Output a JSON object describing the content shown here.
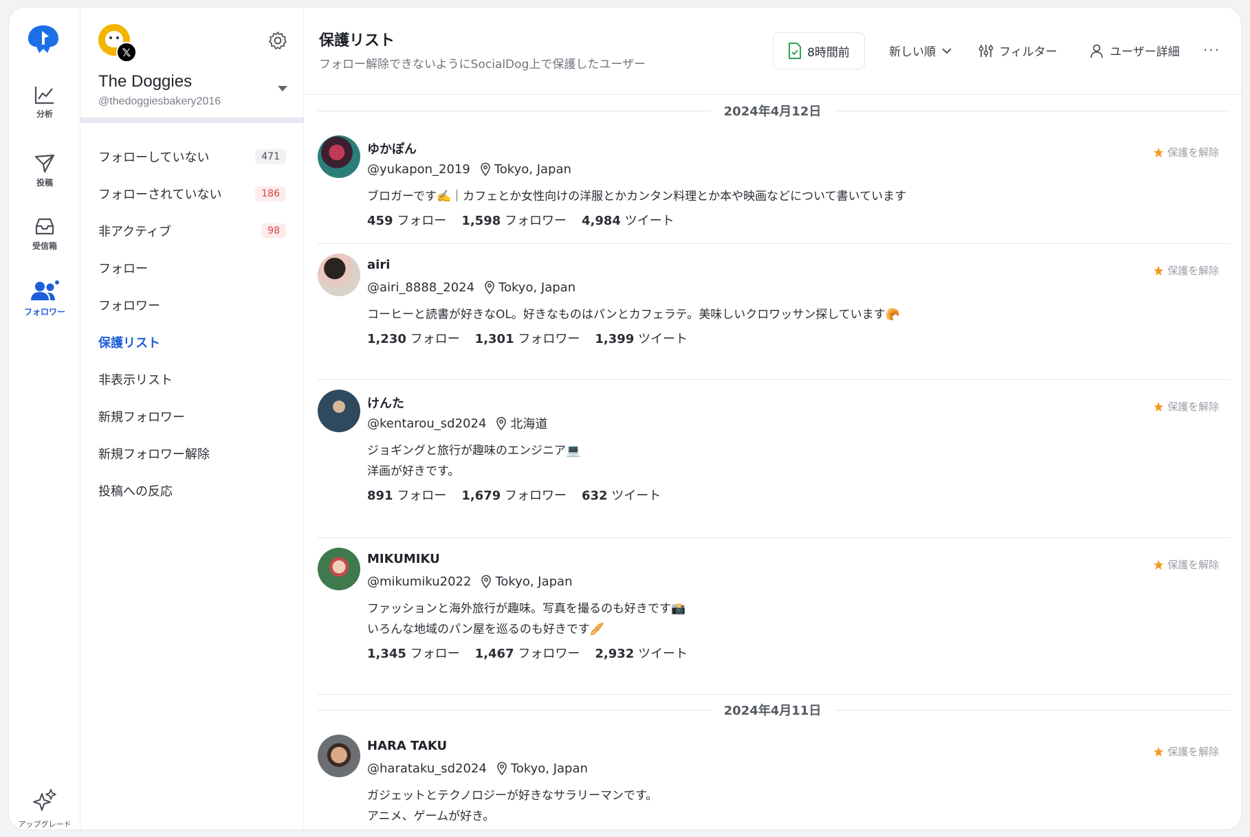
{
  "rail": {
    "items": [
      {
        "label": "分析",
        "icon": "chart-line-icon"
      },
      {
        "label": "投稿",
        "icon": "send-icon"
      },
      {
        "label": "受信箱",
        "icon": "inbox-icon"
      },
      {
        "label": "フォロワー",
        "icon": "users-icon"
      }
    ],
    "upgrade_label": "アップグレード",
    "accent": "#1d5fd8"
  },
  "account": {
    "name": "The Doggies",
    "handle": "@thedoggiesbakery2016"
  },
  "nav": {
    "items": [
      {
        "label": "フォローしていない",
        "count": "471"
      },
      {
        "label": "フォローされていない",
        "count": "186"
      },
      {
        "label": "非アクティブ",
        "count": "98"
      },
      {
        "label": "フォロー"
      },
      {
        "label": "フォロワー"
      },
      {
        "label": "保護リスト"
      },
      {
        "label": "非表示リスト"
      },
      {
        "label": "新規フォロワー"
      },
      {
        "label": "新規フォロワー解除"
      },
      {
        "label": "投稿への反応"
      }
    ]
  },
  "header": {
    "title": "保護リスト",
    "subtitle": "フォロー解除できないようにSocialDog上で保護したユーザー",
    "time_label": "8時間前",
    "sort_label": "新しい順",
    "filter_label": "フィルター",
    "user_detail_label": "ユーザー詳細",
    "more": "···"
  },
  "labels": {
    "follow": "フォロー",
    "followers": "フォロワー",
    "tweets": "ツイート",
    "unprotect": "保護を解除"
  },
  "groups": [
    {
      "date": "2024年4月12日",
      "users": [
        {
          "name": "ゆかぽん",
          "handle": "@yukapon_2019",
          "location": "Tokyo, Japan",
          "bio": [
            "ブロガーです✍️｜カフェとか女性向けの洋服とかカンタン料理とか本や映画などについて書いています"
          ],
          "follow": "459",
          "followers": "1,598",
          "tweets": "4,984"
        },
        {
          "name": "airi",
          "handle": "@airi_8888_2024",
          "location": "Tokyo, Japan",
          "bio": [
            " コーヒーと読書が好きなOL。好きなものはパンとカフェラテ。美味しいクロワッサン探しています🥐"
          ],
          "follow": "1,230",
          "followers": "1,301",
          "tweets": "1,399"
        },
        {
          "name": "けんた",
          "handle": "@kentarou_sd2024",
          "location": "北海道",
          "bio": [
            "ジョギングと旅行が趣味のエンジニア💻",
            "洋画が好きです。"
          ],
          "follow": "891",
          "followers": "1,679",
          "tweets": "632"
        },
        {
          "name": "MIKUMIKU",
          "handle": "@mikumiku2022",
          "location": "Tokyo, Japan",
          "bio": [
            "ファッションと海外旅行が趣味。写真を撮るのも好きです📸",
            "いろんな地域のパン屋を巡るのも好きです🥖"
          ],
          "follow": "1,345",
          "followers": "1,467",
          "tweets": "2,932"
        }
      ]
    },
    {
      "date": "2024年4月11日",
      "users": [
        {
          "name": "HARA TAKU",
          "handle": "@harataku_sd2024",
          "location": "Tokyo, Japan",
          "bio": [
            "ガジェットとテクノロジーが好きなサラリーマンです。",
            "アニメ、ゲームが好き。"
          ],
          "follow": "",
          "followers": "",
          "tweets": ""
        }
      ]
    }
  ]
}
